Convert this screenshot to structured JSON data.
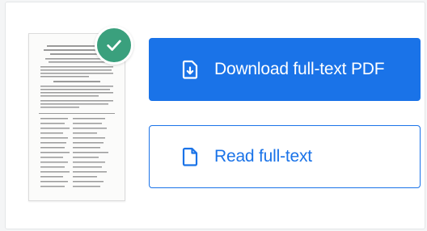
{
  "actions": {
    "download_label": "Download full-text PDF",
    "read_label": "Read full-text"
  },
  "icons": {
    "badge": "check-icon",
    "download": "file-download-icon",
    "read": "file-icon"
  },
  "colors": {
    "primary": "#1a73e8",
    "badge": "#3aa07d",
    "card_bg": "#ffffff"
  }
}
